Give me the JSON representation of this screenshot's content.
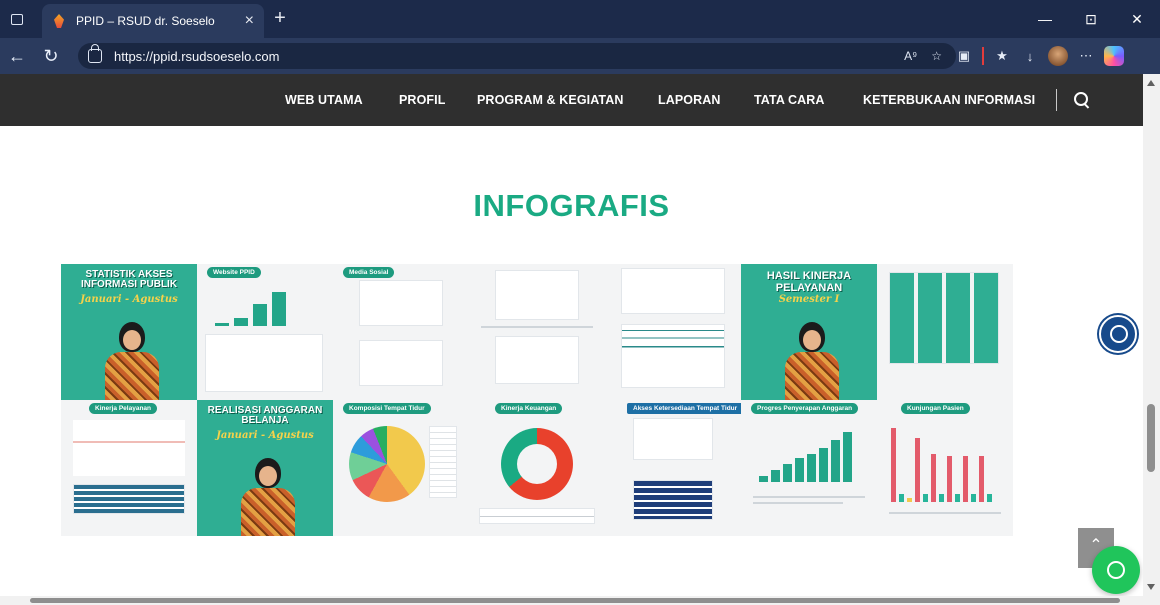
{
  "browser": {
    "tab_title": "PPID – RSUD dr. Soeselo",
    "tab_close": "×",
    "new_tab": "+",
    "url": "https://ppid.rsudsoeselo.com",
    "window_controls": [
      "—",
      "⊡",
      "✕"
    ]
  },
  "site": {
    "nav": [
      "WEB UTAMA",
      "PROFIL",
      "PROGRAM & KEGIATAN",
      "LAPORAN",
      "TATA CARA",
      "KETERBUKAAN INFORMASI"
    ],
    "section_title": "INFOGRAFIS"
  },
  "infographics": {
    "row1": [
      {
        "title": "STATISTIK AKSES INFORMASI PUBLIK",
        "subtitle": "Januari - Agustus",
        "kind": "cover"
      },
      {
        "title": "Website PPID",
        "kind": "bars"
      },
      {
        "title": "Media Sosial",
        "kind": "lines"
      },
      {
        "title": "",
        "kind": "lines"
      },
      {
        "title": "",
        "kind": "hbars"
      },
      {
        "title": "HASIL KINERJA PELAYANAN",
        "subtitle": "Semester I",
        "kind": "cover"
      },
      {
        "title": "",
        "kind": "collage"
      }
    ],
    "row2": [
      {
        "title": "Kinerja Pelayanan",
        "kind": "table"
      },
      {
        "title": "REALISASI ANGGARAN BELANJA",
        "subtitle": "Januari - Agustus",
        "kind": "cover"
      },
      {
        "title": "Komposisi Tempat Tidur",
        "kind": "pie"
      },
      {
        "title": "Kinerja Keuangan",
        "kind": "donut"
      },
      {
        "title": "Akses Ketersediaan Tempat Tidur",
        "kind": "screens"
      },
      {
        "title": "Progres Penyerapan Anggaran",
        "kind": "bars"
      },
      {
        "title": "Kunjungan Pasien",
        "kind": "columns"
      }
    ]
  },
  "colors": {
    "brand_green": "#1aaa83",
    "nav_bg": "#2f2f2f",
    "whatsapp": "#20c55b"
  }
}
